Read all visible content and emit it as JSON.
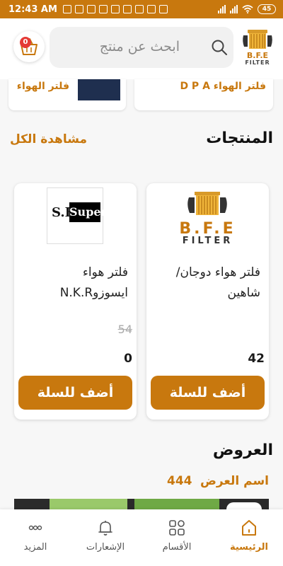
{
  "status_bar": {
    "time": "12:43 AM",
    "battery": "45"
  },
  "header": {
    "logo_line1": "B.F.E",
    "logo_line2": "FILTER",
    "search_placeholder": "ابحث عن منتج",
    "cart_count": "0"
  },
  "categories": [
    {
      "label": "فلتر الهواء"
    },
    {
      "label": "فلتر الهواء D P A"
    }
  ],
  "products_section": {
    "title": "المنتجات",
    "see_all": "مشاهدة الكل",
    "items": [
      {
        "name": "فلتر هواء دوجان/ شاهين",
        "old_price": "",
        "price": "42",
        "add_label": "أضف للسلة",
        "image": "bfe-filter-logo"
      },
      {
        "name": "فلتر هواء ايسوزوN.K.R",
        "old_price": "54",
        "price": "0",
        "add_label": "أضف للسلة",
        "image": "sf-super-logo",
        "image_text_left": "S.F",
        "image_text_right": "Super"
      }
    ]
  },
  "offers_section": {
    "title": "العروض",
    "offer_name": "اسم العرض",
    "offer_value": "444"
  },
  "bottom_nav": [
    {
      "label": "الرئيسية",
      "icon": "home-icon",
      "active": true
    },
    {
      "label": "الأقسام",
      "icon": "grid-icon",
      "active": false
    },
    {
      "label": "الإشعارات",
      "icon": "bell-icon",
      "active": false
    },
    {
      "label": "المزيد",
      "icon": "more-dots-icon",
      "active": false
    }
  ],
  "colors": {
    "accent": "#c8780e",
    "badge": "#e53935",
    "background": "#f7f7f7"
  }
}
